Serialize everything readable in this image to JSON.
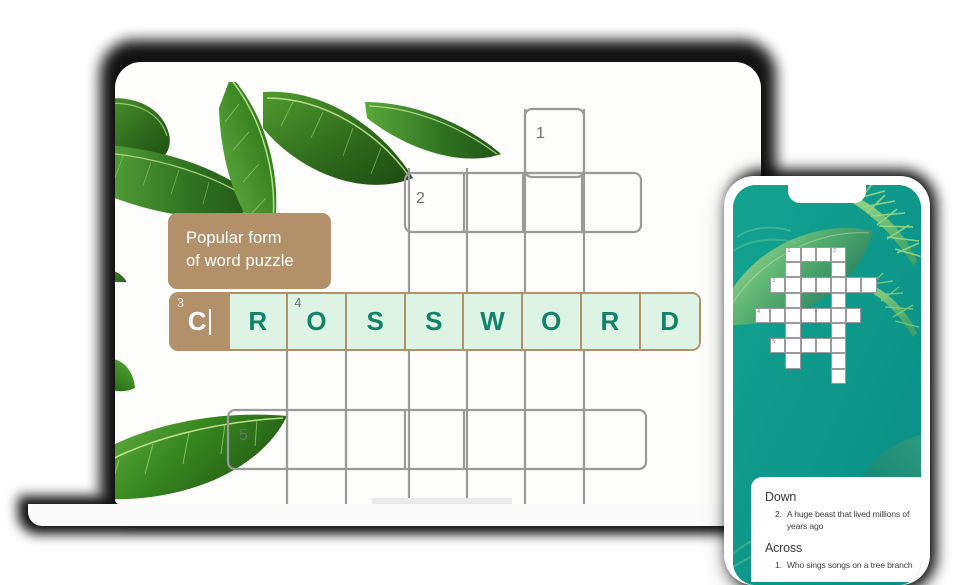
{
  "scene": {
    "title": "Crossword puzzle app on laptop and phone",
    "devices": [
      "laptop",
      "phone"
    ]
  },
  "laptop": {
    "tooltip": {
      "line1": "Popular form",
      "line2": "of word puzzle",
      "bg_color": "#b2906a",
      "text_color": "#ffffff"
    },
    "grid": {
      "clue_numbers": [
        "1",
        "2",
        "3",
        "4",
        "5"
      ],
      "active_word": "CROSSWORD",
      "active_word_number": "3",
      "active_cell_letter": "C",
      "active_cell_index": 0,
      "letters": [
        {
          "char": "C",
          "number": "3",
          "active": true
        },
        {
          "char": "R",
          "number": "",
          "active": false
        },
        {
          "char": "O",
          "number": "4",
          "active": false
        },
        {
          "char": "S",
          "number": "",
          "active": false
        },
        {
          "char": "S",
          "number": "",
          "active": false
        },
        {
          "char": "W",
          "number": "",
          "active": false
        },
        {
          "char": "O",
          "number": "",
          "active": false
        },
        {
          "char": "R",
          "number": "",
          "active": false
        },
        {
          "char": "D",
          "number": "",
          "active": false
        }
      ],
      "cell_fill_color": "#ddf3e4",
      "letter_color": "#12836a",
      "active_fill_color": "#b2906a",
      "grid_line_color": "#9a9a9a"
    }
  },
  "phone": {
    "screen_bg_color": "#0f9f93",
    "grid": {
      "clue_numbers": [
        "1",
        "2",
        "3",
        "4",
        "5"
      ]
    },
    "clues": {
      "down_heading": "Down",
      "down_items": [
        {
          "number": "2.",
          "text": "A huge beast that lived millions of years ago"
        }
      ],
      "across_heading": "Across",
      "across_items": [
        {
          "number": "1.",
          "text": "Who sings songs on a tree branch"
        }
      ]
    }
  }
}
